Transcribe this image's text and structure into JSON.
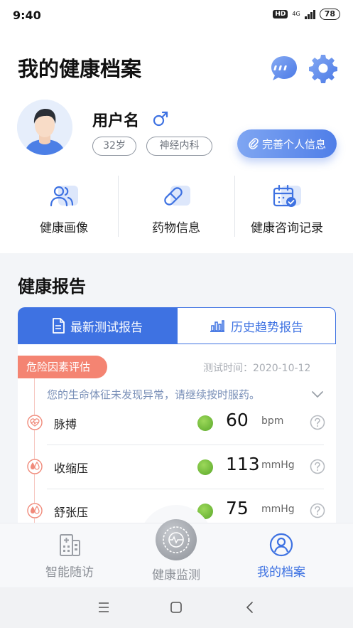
{
  "status": {
    "time": "9:40",
    "hd": "HD",
    "network": "4G",
    "battery": "78"
  },
  "header": {
    "title": "我的健康档案"
  },
  "profile": {
    "username": "用户名",
    "age_tag": "32岁",
    "dept_tag": "神经内科",
    "complete_button": "完善个人信息"
  },
  "quick_links": [
    {
      "label": "健康画像",
      "icon": "people-icon"
    },
    {
      "label": "药物信息",
      "icon": "pill-icon"
    },
    {
      "label": "健康咨询记录",
      "icon": "calendar-check-icon"
    }
  ],
  "report": {
    "title": "健康报告",
    "tabs": [
      {
        "label": "最新测试报告",
        "active": true
      },
      {
        "label": "历史趋势报告",
        "active": false
      }
    ],
    "risk_badge": "危险因素评估",
    "test_time": "测试时间：2020-10-12",
    "notice": "您的生命体征未发现异常，请继续按时服药。",
    "metrics": [
      {
        "name": "脉搏",
        "value": "60",
        "unit": "bpm",
        "icon": "heart-pulse-icon"
      },
      {
        "name": "收缩压",
        "value": "113",
        "unit": "mmHg",
        "icon": "blood-pressure-icon"
      },
      {
        "name": "舒张压",
        "value": "75",
        "unit": "mmHg",
        "icon": "blood-pressure-icon"
      }
    ]
  },
  "bottom_nav": [
    {
      "label": "智能随访",
      "active": false
    },
    {
      "label": "健康监测",
      "active": false
    },
    {
      "label": "我的档案",
      "active": true
    }
  ],
  "colors": {
    "primary": "#3e72e2",
    "risk": "#f48472",
    "ok": "#6cbf3a"
  }
}
